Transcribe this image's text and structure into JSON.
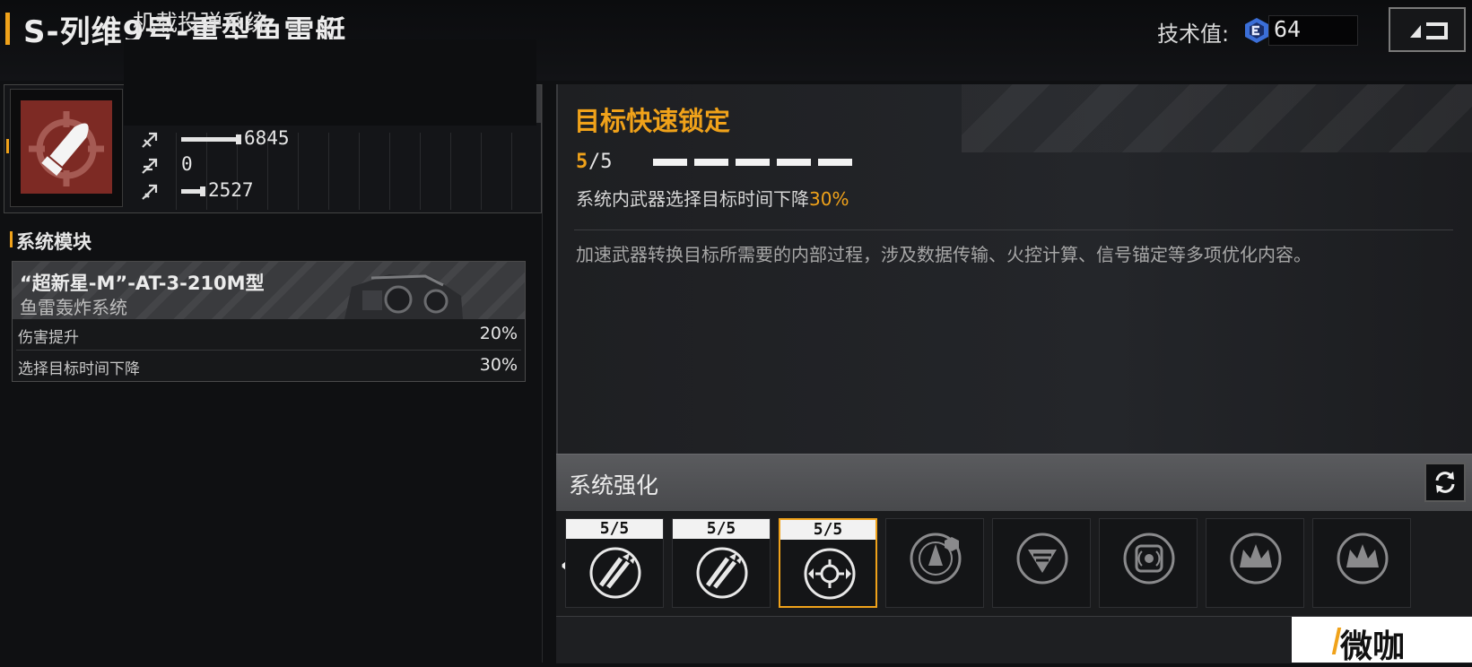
{
  "header": {
    "title": "S-列维9号-重型鱼雷艇",
    "tech_label": "技术值:",
    "tech_value": "64"
  },
  "weapon": {
    "name": "机载投弹系统",
    "stats": [
      {
        "icon": "damage-stat-icon",
        "value": "6845",
        "level": 0.64
      },
      {
        "icon": "penetration-stat-icon",
        "value": "0",
        "level": 0.0
      },
      {
        "icon": "accuracy-stat-icon",
        "value": "2527",
        "level": 0.24
      }
    ]
  },
  "system_module": {
    "section_title": "系统模块",
    "name": "“超新星-M”-AT-3-210M型",
    "subtitle": "鱼雷轰炸系统",
    "rows": [
      {
        "label": "伤害提升",
        "value": "20%"
      },
      {
        "label": "选择目标时间下降",
        "value": "30%"
      }
    ]
  },
  "skill": {
    "title": "目标快速锁定",
    "level_current": "5",
    "level_rest": "/5",
    "effect_prefix": "系统内武器选择目标时间下降",
    "effect_value": "30%",
    "description": "加速武器转换目标所需要的内部过程，涉及数据传输、火控计算、信号锚定等多项优化内容。"
  },
  "enhancement": {
    "title": "系统强化",
    "tiles": [
      {
        "level": "5/5",
        "icon": "missile-upgrade-icon",
        "selected": false,
        "locked": false
      },
      {
        "level": "5/5",
        "icon": "missile-upgrade-icon",
        "selected": false,
        "locked": false
      },
      {
        "level": "5/5",
        "icon": "target-lock-icon",
        "selected": true,
        "locked": false
      },
      {
        "icon": "rocket-shield-icon",
        "locked": true
      },
      {
        "icon": "crest-icon",
        "locked": true
      },
      {
        "icon": "signal-chip-icon",
        "locked": true
      },
      {
        "icon": "crown-burst-icon",
        "locked": true
      },
      {
        "icon": "crown-burst-icon",
        "locked": true
      }
    ]
  },
  "watermark": "微咖",
  "colors": {
    "accent": "#f0a21a",
    "weapon_icon_bg": "#7d2a24"
  }
}
